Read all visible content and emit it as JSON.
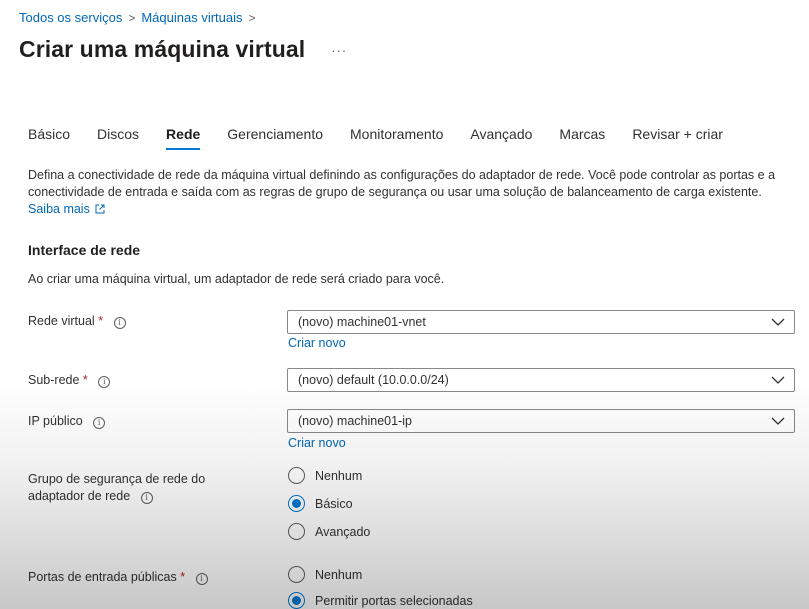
{
  "breadcrumb": {
    "items": [
      "Todos os serviços",
      "Máquinas virtuais"
    ],
    "separator": ">"
  },
  "page": {
    "title": "Criar uma máquina virtual",
    "more": "···"
  },
  "tabs": [
    {
      "label": "Básico",
      "active": false
    },
    {
      "label": "Discos",
      "active": false
    },
    {
      "label": "Rede",
      "active": true
    },
    {
      "label": "Gerenciamento",
      "active": false
    },
    {
      "label": "Monitoramento",
      "active": false
    },
    {
      "label": "Avançado",
      "active": false
    },
    {
      "label": "Marcas",
      "active": false
    },
    {
      "label": "Revisar + criar",
      "active": false
    }
  ],
  "description": {
    "text": "Defina a conectividade de rede da máquina virtual definindo as configurações do adaptador de rede. Você pode controlar as portas e a conectividade de entrada e saída com as regras de grupo de segurança ou usar uma solução de balanceamento de carga existente.",
    "learn_more": "Saiba mais"
  },
  "section": {
    "title": "Interface de rede",
    "subtitle": "Ao criar uma máquina virtual, um adaptador de rede será criado para você."
  },
  "fields": {
    "virtual_network": {
      "label": "Rede virtual",
      "required": "*",
      "value": "(novo) machine01-vnet",
      "create_new": "Criar novo"
    },
    "subnet": {
      "label": "Sub-rede",
      "required": "*",
      "value": "(novo) default (10.0.0.0/24)"
    },
    "public_ip": {
      "label": "IP público",
      "value": "(novo) machine01-ip",
      "create_new": "Criar novo"
    },
    "nsg": {
      "label_line1": "Grupo de segurança de rede do",
      "label_line2": "adaptador de rede",
      "options": [
        "Nenhum",
        "Básico",
        "Avançado"
      ],
      "selected": "Básico"
    },
    "public_inbound_ports": {
      "label": "Portas de entrada públicas",
      "required": "*",
      "options": [
        "Nenhum",
        "Permitir portas selecionadas"
      ],
      "selected": "Permitir portas selecionadas"
    }
  },
  "colors": {
    "accent": "#0078d4",
    "link": "#0067b8",
    "required": "#a4262c"
  },
  "icons": {
    "info": "info-icon",
    "chevron": "chevron-down-icon",
    "external": "external-link-icon"
  }
}
